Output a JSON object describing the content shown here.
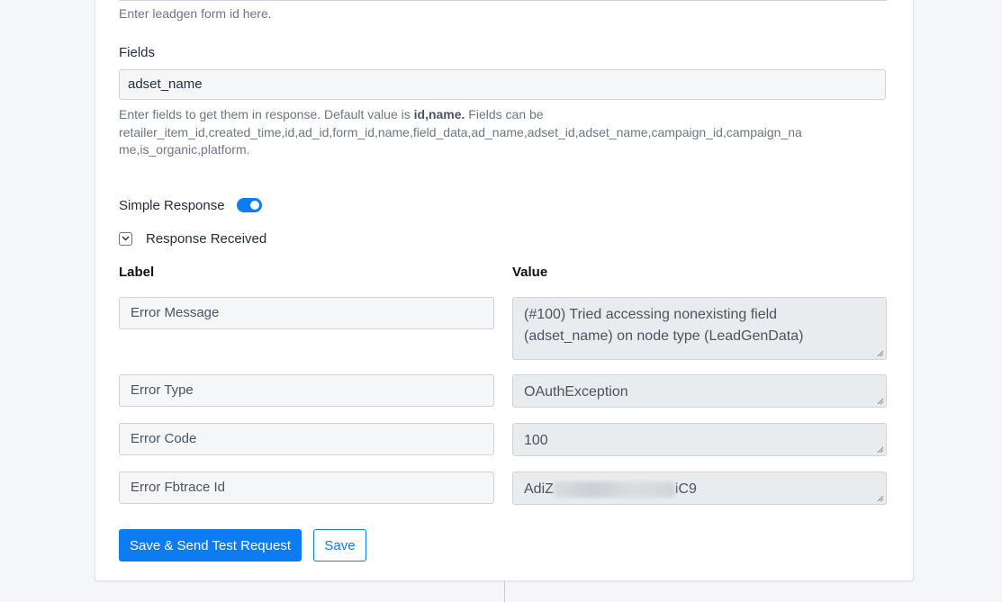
{
  "form_id": {
    "help": "Enter leadgen form id here."
  },
  "fields": {
    "label": "Fields",
    "value": "adset_name",
    "help_prefix": "Enter fields to get them in response. Default value is ",
    "help_bold": "id,name.",
    "help_suffix": " Fields can be",
    "help_line2": "retailer_item_id,created_time,id,ad_id,form_id,name,field_data,ad_name,adset_id,adset_name,campaign_id,campaign_na",
    "help_line3": "me,is_organic,platform."
  },
  "simple_response": {
    "label": "Simple Response",
    "enabled": true
  },
  "response_received": {
    "label": "Response Received",
    "icon": "chevron-down-icon"
  },
  "table": {
    "label_header": "Label",
    "value_header": "Value",
    "rows": [
      {
        "label": "Error Message",
        "value_line1": "(#100) Tried accessing nonexisting field",
        "value_line2": "(adset_name) on node type (LeadGenData)"
      },
      {
        "label": "Error Type",
        "value": "OAuthException"
      },
      {
        "label": "Error Code",
        "value": "100"
      },
      {
        "label": "Error Fbtrace Id",
        "value_prefix": "AdiZ",
        "value_suffix": "iC9"
      }
    ]
  },
  "actions": {
    "send_label": "Save & Send Test Request",
    "save_label": "Save"
  },
  "colors": {
    "accent": "#0d7bf2",
    "background": "#f4f6f9"
  }
}
